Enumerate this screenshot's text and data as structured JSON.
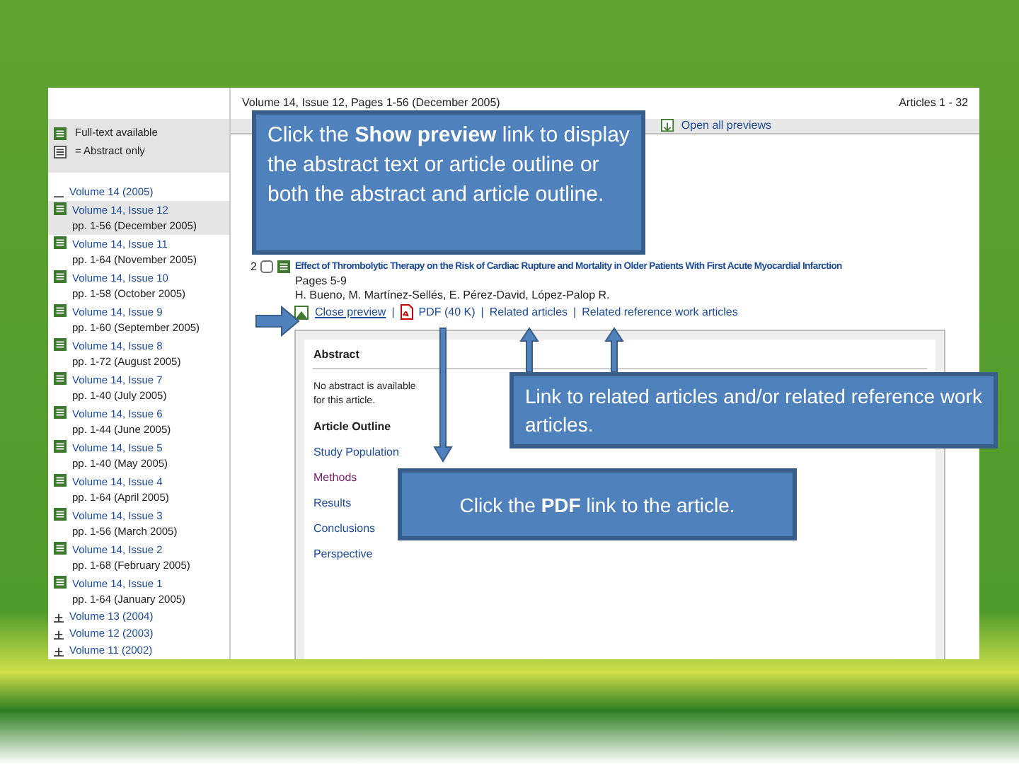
{
  "screenshot": {
    "sidebar": {
      "legend": [
        {
          "kind": "full",
          "label": "Full-text available"
        },
        {
          "kind": "abstract",
          "label": "= Abstract only"
        }
      ],
      "volumes": [
        {
          "label": "Volume 14 (2005)",
          "expanded": true,
          "children": [
            {
              "label": "Volume 14, Issue 12",
              "pages": "pp. 1-56 (December 2005)",
              "selected": true
            },
            {
              "label": "Volume 14, Issue 11",
              "pages": "pp. 1-64 (November 2005)",
              "selected": false
            },
            {
              "label": "Volume 14, Issue 10",
              "pages": "pp. 1-58 (October 2005)",
              "selected": false
            },
            {
              "label": "Volume 14, Issue 9",
              "pages": "pp. 1-60 (September 2005)",
              "selected": false
            },
            {
              "label": "Volume 14, Issue 8",
              "pages": "pp. 1-72 (August 2005)",
              "selected": false
            },
            {
              "label": "Volume 14, Issue 7",
              "pages": "pp. 1-40 (July 2005)",
              "selected": false
            },
            {
              "label": "Volume 14, Issue 6",
              "pages": "pp. 1-44 (June 2005)",
              "selected": false
            },
            {
              "label": "Volume 14, Issue 5",
              "pages": "pp. 1-40 (May 2005)",
              "selected": false
            },
            {
              "label": "Volume 14, Issue 4",
              "pages": "pp. 1-64 (April 2005)",
              "selected": false
            },
            {
              "label": "Volume 14, Issue 3",
              "pages": "pp. 1-56 (March 2005)",
              "selected": false
            },
            {
              "label": "Volume 14, Issue 2",
              "pages": "pp. 1-68 (February 2005)",
              "selected": false
            },
            {
              "label": "Volume 14, Issue 1",
              "pages": "pp. 1-64 (January 2005)",
              "selected": false
            }
          ]
        },
        {
          "label": "Volume 13 (2004)",
          "expanded": false
        },
        {
          "label": "Volume 12 (2003)",
          "expanded": false
        },
        {
          "label": "Volume 11 (2002)",
          "expanded": false
        }
      ]
    },
    "header": {
      "title": "Volume 14, Issue 12, Pages 1-56 (December 2005)",
      "count": "Articles 1 - 32"
    },
    "toolbar": {
      "open_all": "Open all previews"
    },
    "article": {
      "number": "2",
      "checked": false,
      "title": "Effect of Thrombolytic Therapy on the Risk of Cardiac Rupture and Mortality in Older Patients With First Acute Myocardial Infarction",
      "pages": "Pages 5-9",
      "authors": "H. Bueno, M. Martínez-Sellés, E. Pérez-David, López-Palop R.",
      "links": [
        "Close preview",
        "PDF (40 K)",
        "Related articles",
        "Related reference work articles"
      ],
      "separator": "|",
      "preview": {
        "heading": "Abstract",
        "abstract": "No abstract is available for this article.",
        "outline_heading": "Article Outline",
        "outline": [
          {
            "label": "Study Population",
            "visited": false
          },
          {
            "label": "Methods",
            "visited": true
          },
          {
            "label": "Results",
            "visited": false
          },
          {
            "label": "Conclusions",
            "visited": false
          },
          {
            "label": "Perspective",
            "visited": false
          }
        ]
      }
    }
  },
  "callouts": [
    {
      "text": "Click the **Show preview** link to display the abstract text or article outline or both the abstract and article outline."
    },
    {
      "text": "Link to related articles and/or related reference work articles."
    },
    {
      "text": "Click the **PDF** link to the article."
    }
  ]
}
